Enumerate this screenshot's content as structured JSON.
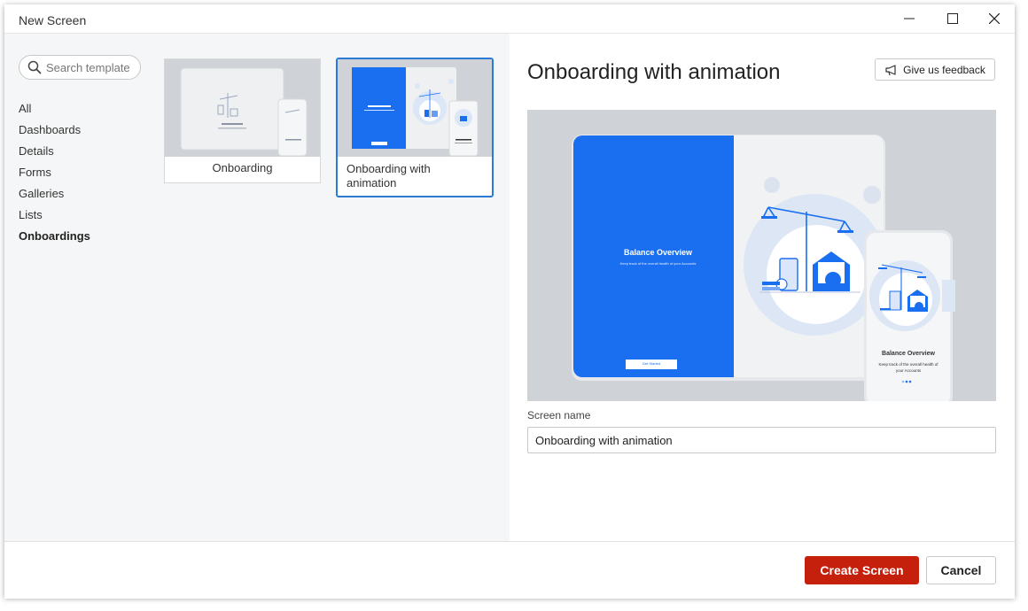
{
  "window": {
    "title": "New Screen"
  },
  "search": {
    "placeholder": "Search template"
  },
  "categories": [
    {
      "label": "All",
      "active": false
    },
    {
      "label": "Dashboards",
      "active": false
    },
    {
      "label": "Details",
      "active": false
    },
    {
      "label": "Forms",
      "active": false
    },
    {
      "label": "Galleries",
      "active": false
    },
    {
      "label": "Lists",
      "active": false
    },
    {
      "label": "Onboardings",
      "active": true
    }
  ],
  "templates": [
    {
      "label": "Onboarding",
      "selected": false
    },
    {
      "label": "Onboarding with animation",
      "selected": true
    }
  ],
  "preview": {
    "title": "Onboarding with animation",
    "feedback_label": "Give us feedback",
    "image": {
      "tablet_heading": "Balance Overview",
      "tablet_subtext": "Keep track of the overall health of your Accounts",
      "tablet_button": "Get Started",
      "phone_heading": "Balance Overview",
      "phone_subtext": "Keep track of the overall health of your Accounts"
    }
  },
  "form": {
    "screen_name_label": "Screen name",
    "screen_name_value": "Onboarding with animation"
  },
  "footer": {
    "create_label": "Create Screen",
    "cancel_label": "Cancel"
  },
  "colors": {
    "primary_button": "#c4200c",
    "selection_border": "#2b7bd6",
    "illustration_blue": "#1a6ff0"
  }
}
